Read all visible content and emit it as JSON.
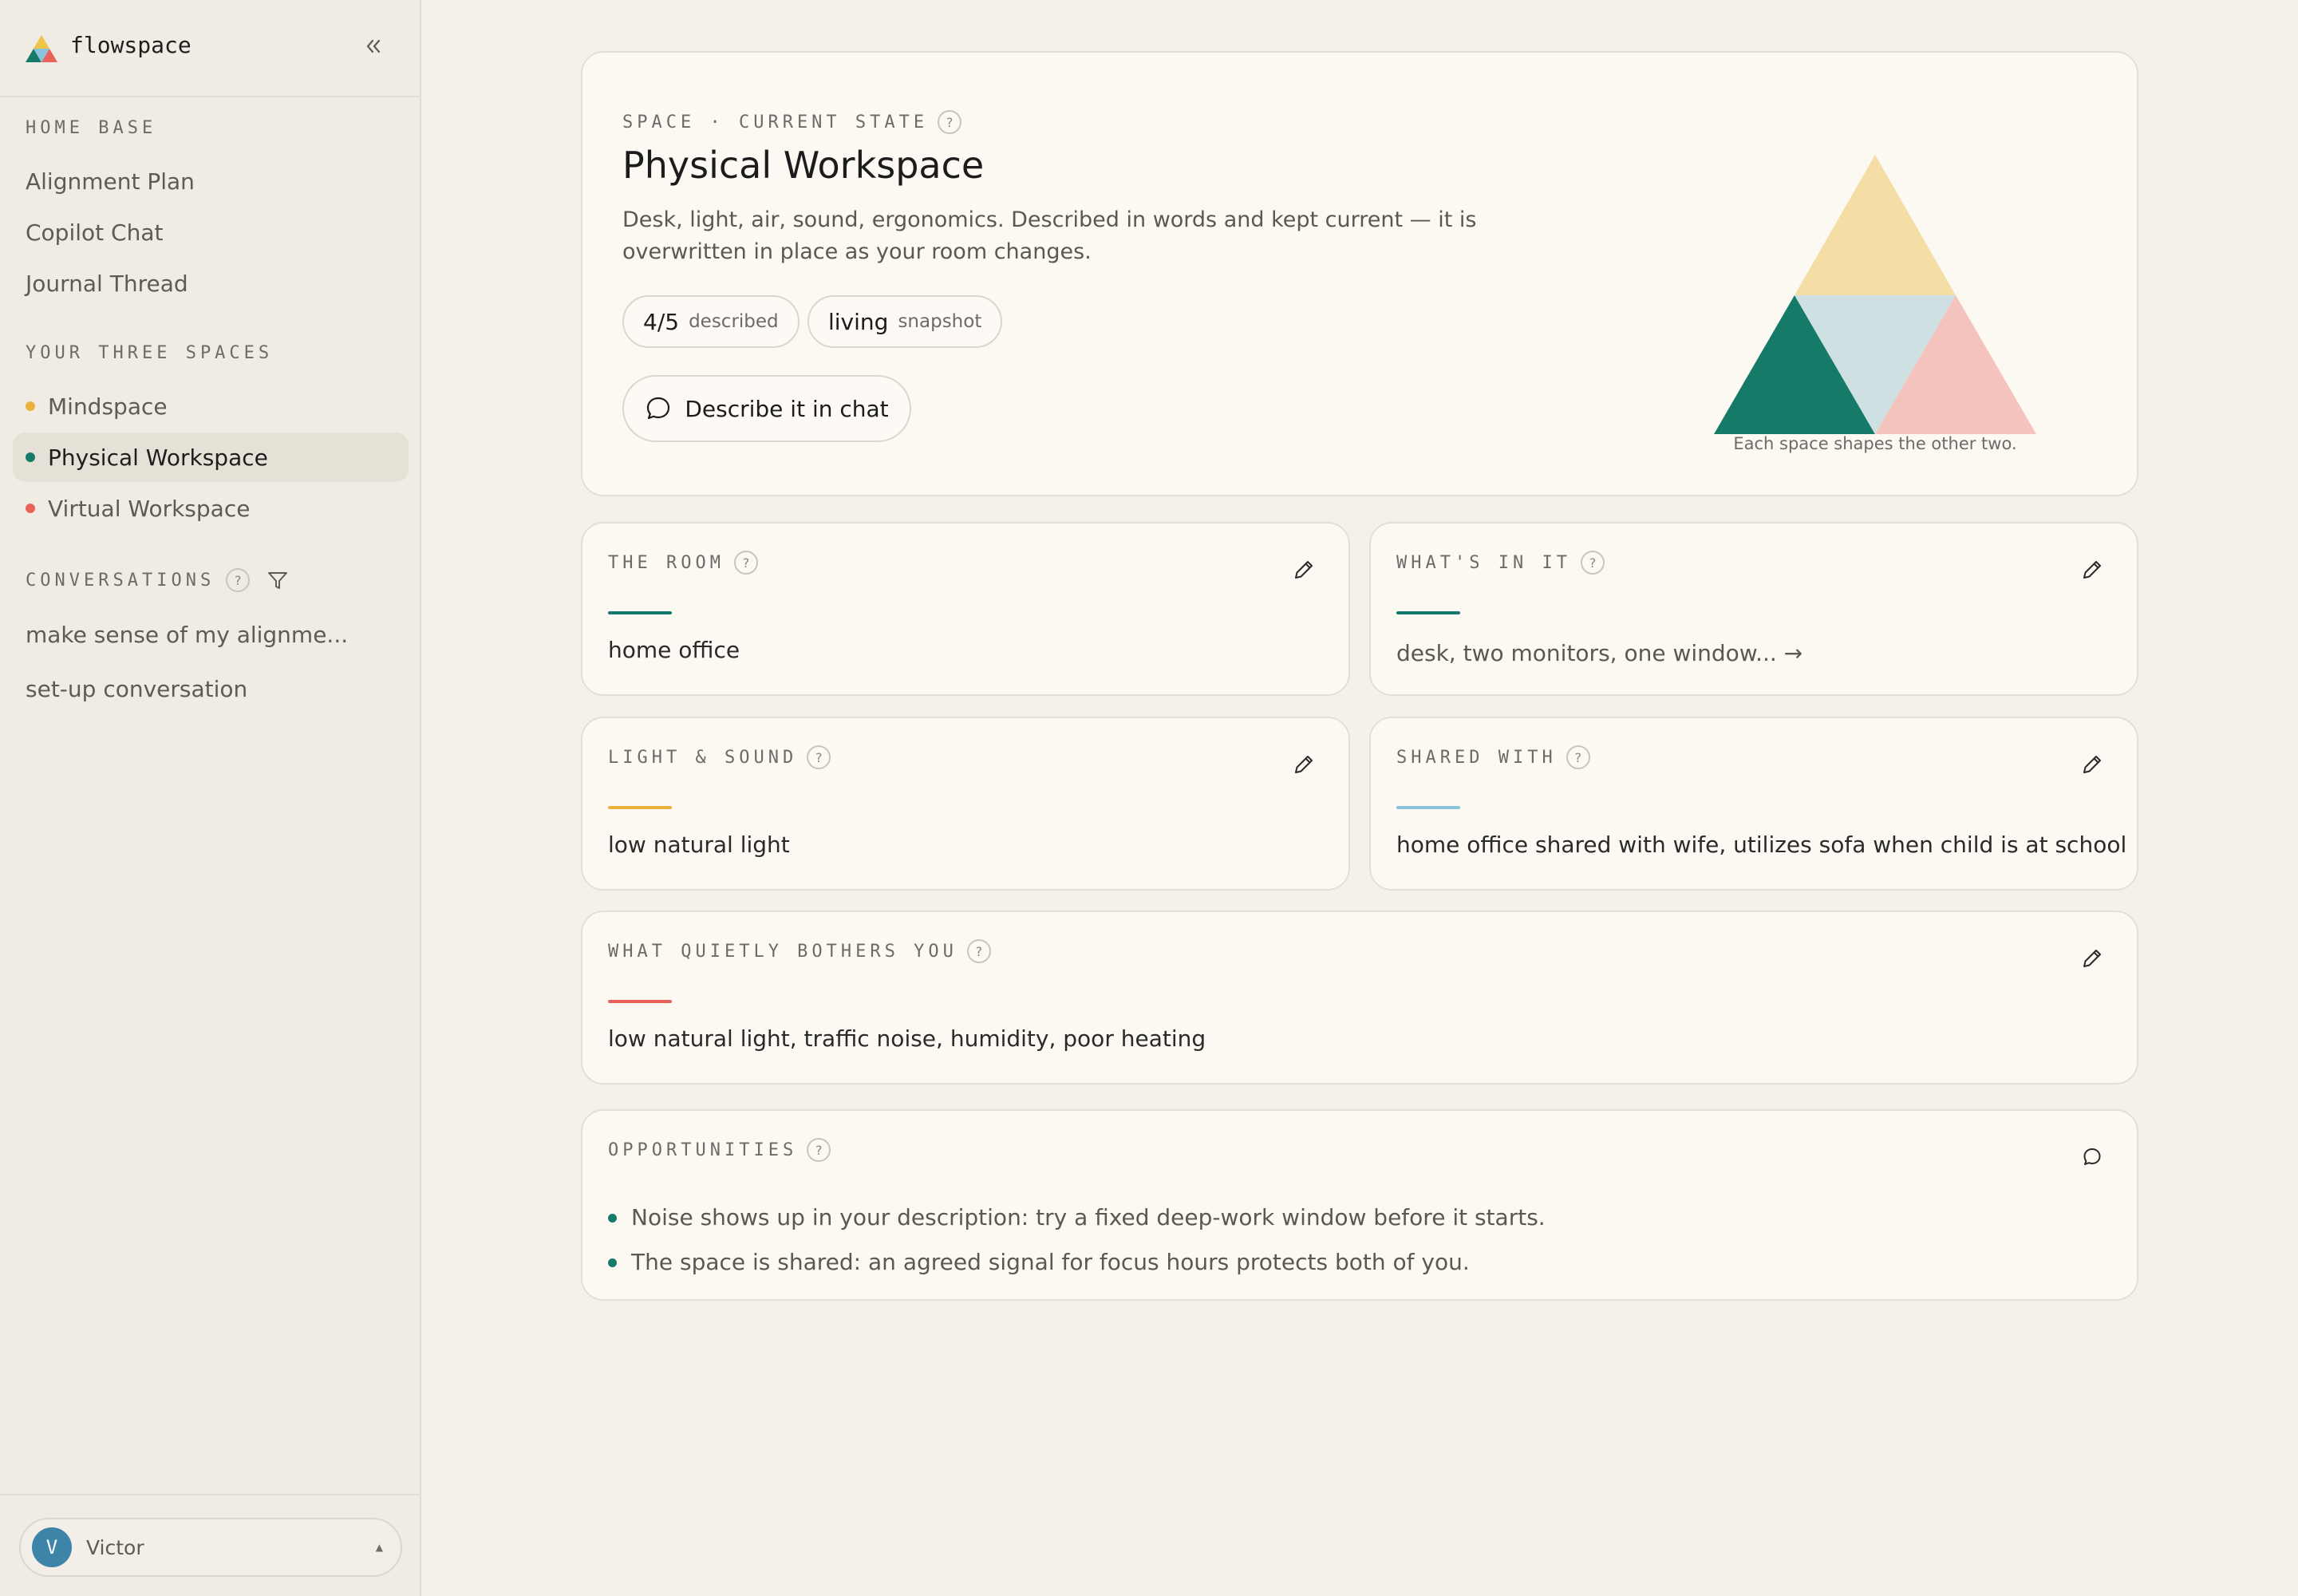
{
  "brand": {
    "name": "flowspace"
  },
  "sidebar": {
    "home_base_title": "HOME BASE",
    "home_base_items": [
      {
        "label": "Alignment Plan"
      },
      {
        "label": "Copilot Chat"
      },
      {
        "label": "Journal Thread"
      }
    ],
    "spaces_title": "YOUR THREE SPACES",
    "spaces": [
      {
        "label": "Mindspace",
        "color": "#e9b23a",
        "active": false
      },
      {
        "label": "Physical Workspace",
        "color": "#157a67",
        "active": true
      },
      {
        "label": "Virtual Workspace",
        "color": "#e8625a",
        "active": false
      }
    ],
    "conversations_title": "CONVERSATIONS",
    "conversations": [
      {
        "label": "make sense of my alignme..."
      },
      {
        "label": "set-up conversation"
      }
    ],
    "user": {
      "initial": "V",
      "name": "Victor"
    }
  },
  "hero": {
    "eyebrow": "SPACE · CURRENT STATE",
    "title": "Physical Workspace",
    "description": "Desk, light, air, sound, ergonomics. Described in words and kept current — it is overwritten in place as your room changes.",
    "stat1": {
      "big": "4/5",
      "small": "described"
    },
    "stat2": {
      "big": "living",
      "small": "snapshot"
    },
    "chat_button": "Describe it in chat",
    "triangle_caption": "Each space shapes the other two."
  },
  "fields": {
    "room": {
      "title": "THE ROOM",
      "value": "home office",
      "accent": "#157a67"
    },
    "contents": {
      "title": "WHAT'S IN IT",
      "value": "desk, two monitors, one window... →",
      "accent": "#157a67"
    },
    "light": {
      "title": "LIGHT & SOUND",
      "value": "low natural light",
      "accent": "#e9b23a"
    },
    "shared": {
      "title": "SHARED WITH",
      "value": "home office shared with wife, utilizes sofa when child is at school",
      "accent": "#8cc3dc"
    },
    "bothers": {
      "title": "WHAT QUIETLY BOTHERS YOU",
      "value": "low natural light, traffic noise, humidity, poor heating",
      "accent": "#e8625a"
    }
  },
  "opportunities": {
    "title": "OPPORTUNITIES",
    "items": [
      "Noise shows up in your description: try a fixed deep-work window before it starts.",
      "The space is shared: an agreed signal for focus hours protects both of you."
    ]
  },
  "triangle_colors": {
    "top": "#f5dea6",
    "left": "#157a67",
    "center": "#cfe0e3",
    "right": "#f4c3bd"
  },
  "help_glyph": "?"
}
